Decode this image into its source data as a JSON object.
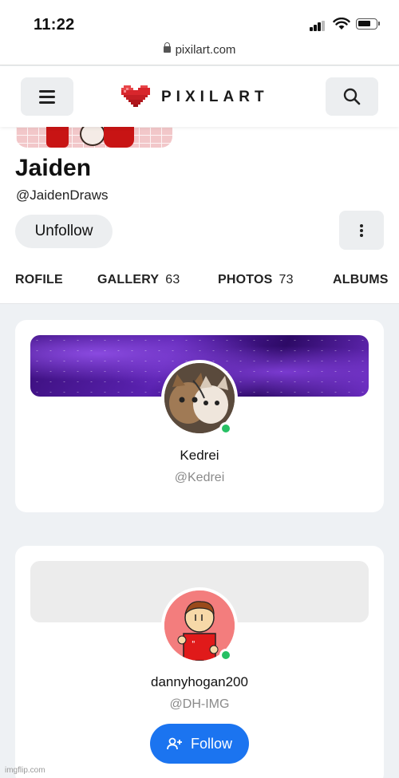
{
  "status_bar": {
    "time": "11:22",
    "url": "pixilart.com"
  },
  "nav": {
    "brand": "PIXILART",
    "menu_icon": "hamburger-icon",
    "search_icon": "search-icon",
    "logo_icon": "pixel-heart-icon"
  },
  "profile": {
    "name": "Jaiden",
    "handle": "@JaidenDraws",
    "unfollow_label": "Unfollow",
    "tabs": [
      {
        "label": "ROFILE",
        "count": ""
      },
      {
        "label": "GALLERY",
        "count": "63"
      },
      {
        "label": "PHOTOS",
        "count": "73"
      },
      {
        "label": "ALBUMS",
        "count": ""
      }
    ]
  },
  "cards": [
    {
      "name": "Kedrei",
      "handle": "@Kedrei",
      "online": true,
      "cover": "purple galaxy"
    },
    {
      "name": "dannyhogan200",
      "handle": "@DH-IMG",
      "online": true,
      "cover": "gray",
      "follow_label": "Follow"
    }
  ],
  "colors": {
    "accent": "#1b74f0",
    "online": "#27c064",
    "brand_red": "#d8262c"
  },
  "watermark": "imgflip.com"
}
